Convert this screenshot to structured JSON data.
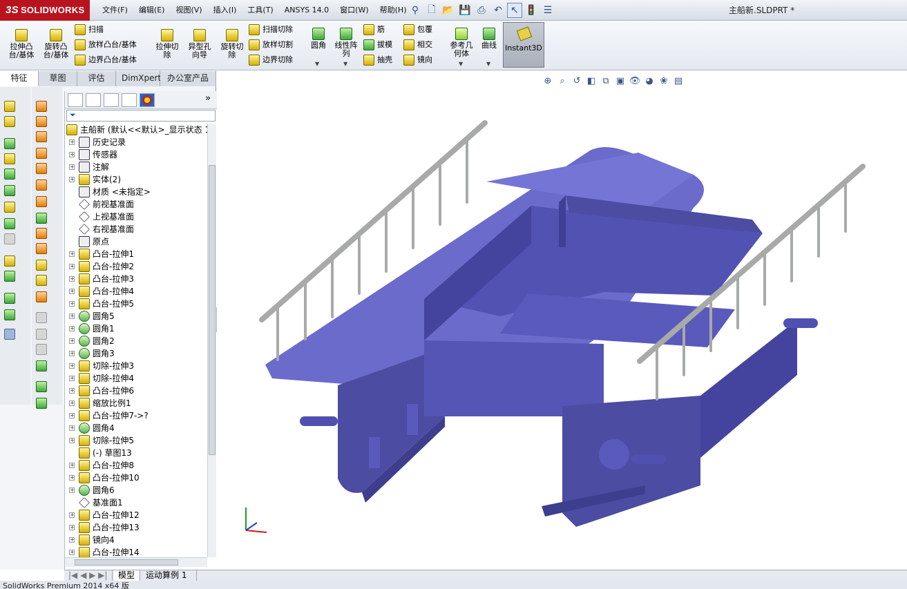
{
  "app": {
    "brand": "SOLIDWORKS",
    "document_title": "主船新.SLDPRT *"
  },
  "menu": [
    "文件(F)",
    "编辑(E)",
    "视图(V)",
    "插入(I)",
    "工具(T)",
    "ANSYS 14.0",
    "窗口(W)",
    "帮助(H)"
  ],
  "command_manager": {
    "big": [
      {
        "label": "拉伸凸\n台/基体"
      },
      {
        "label": "旋转凸\n台/基体"
      },
      {
        "label": "拉伸切\n除"
      },
      {
        "label": "异型孔\n向导"
      },
      {
        "label": "旋转切\n除"
      },
      {
        "label": "圆角"
      },
      {
        "label": "线性阵\n列"
      },
      {
        "label": "参考几\n何体"
      },
      {
        "label": "曲线"
      }
    ],
    "small": [
      "扫描",
      "放样凸台/基体",
      "边界凸台/基体",
      "扫描切除",
      "放样切割",
      "边界切除",
      "筋",
      "拔模",
      "抽壳",
      "包覆",
      "相交",
      "镜向"
    ],
    "instant3d": "Instant3D"
  },
  "tabs": [
    "特征",
    "草图",
    "评估",
    "DimXpert",
    "办公室产品"
  ],
  "tree": {
    "root": "主船新 (默认<<默认>_显示状态 1",
    "items": [
      "历史记录",
      "传感器",
      "注解",
      "实体(2)",
      "材质 <未指定>",
      "前视基准面",
      "上视基准面",
      "右视基准面",
      "原点",
      "凸台-拉伸1",
      "凸台-拉伸2",
      "凸台-拉伸3",
      "凸台-拉伸4",
      "凸台-拉伸5",
      "圆角5",
      "圆角1",
      "圆角2",
      "圆角3",
      "切除-拉伸3",
      "切除-拉伸4",
      "凸台-拉伸6",
      "缩放比例1",
      "凸台-拉伸7->?",
      "圆角4",
      "切除-拉伸5",
      "(-) 草图13",
      "凸台-拉伸8",
      "凸台-拉伸10",
      "圆角6",
      "基准面1",
      "凸台-拉伸12",
      "凸台-拉伸13",
      "镜向4",
      "凸台-拉伸14"
    ]
  },
  "bottom_tabs": [
    "模型",
    "运动算例 1"
  ],
  "status": "SolidWorks Premium 2014 x64 版",
  "colors": {
    "hull": "#6b6bcc",
    "hull_dark": "#4c4ca3",
    "rail": "#a8aaa9",
    "brand": "#b9141e"
  }
}
